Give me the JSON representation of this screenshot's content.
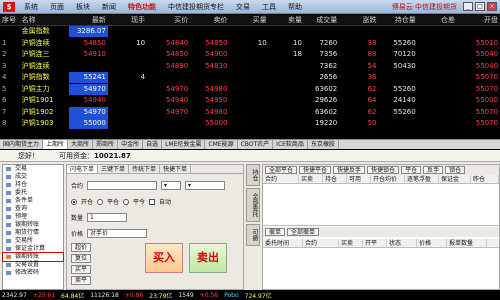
{
  "menubar": {
    "items": [
      "系统",
      "页面",
      "板块",
      "新闻",
      "特色功能",
      "中信建投期货专栏",
      "交易",
      "工具",
      "帮助"
    ],
    "brand": "博易云·中信建投期货",
    "trade_btn": "交易"
  },
  "quote": {
    "headers": [
      "序号",
      "名称",
      "最新",
      "现手",
      "买价",
      "卖价",
      "买量",
      "卖量",
      "成交量",
      "涨跌",
      "持仓量",
      "仓差",
      "开盘"
    ],
    "rows": [
      {
        "no": "",
        "name": "金属指数",
        "last": "3286.07",
        "vol": "",
        "bid": "",
        "ask": "",
        "bq": "",
        "aq": "",
        "tv": "",
        "chg": "",
        "oi": "",
        "oid": "",
        "open": ""
      },
      {
        "no": "1",
        "name": "沪铜连续",
        "last": "54850",
        "vol": "10",
        "bid": "54840",
        "ask": "54850",
        "bq": "10",
        "aq": "10",
        "tv": "7260",
        "chg": "38",
        "oi": "55260",
        "oid": "",
        "open": "55010"
      },
      {
        "no": "2",
        "name": "沪铜连三",
        "last": "54910",
        "vol": "",
        "bid": "54850",
        "ask": "54900",
        "bq": "",
        "aq": "18",
        "tv": "7356",
        "chg": "88",
        "oi": "70120",
        "oid": "",
        "open": "55040"
      },
      {
        "no": "3",
        "name": "沪铜连续",
        "last": "",
        "vol": "",
        "bid": "54890",
        "ask": "54830",
        "bq": "",
        "aq": "",
        "tv": "7362",
        "chg": "54",
        "oi": "50430",
        "oid": "",
        "open": "55040"
      },
      {
        "no": "4",
        "name": "沪铜指数",
        "last": "55241",
        "vol": "4",
        "bid": "",
        "ask": "",
        "bq": "",
        "aq": "",
        "tv": "2656",
        "chg": "36",
        "oi": "",
        "oid": "",
        "open": "55070"
      },
      {
        "no": "5",
        "name": "沪铜主力",
        "last": "54970",
        "vol": "",
        "bid": "54970",
        "ask": "54980",
        "bq": "",
        "aq": "",
        "tv": "63602",
        "chg": "62",
        "oi": "55260",
        "oid": "",
        "open": "55070"
      },
      {
        "no": "6",
        "name": "沪铜1901",
        "last": "54940",
        "vol": "",
        "bid": "54940",
        "ask": "54950",
        "bq": "",
        "aq": "",
        "tv": "29626",
        "chg": "64",
        "oi": "24140",
        "oid": "",
        "open": "55000"
      },
      {
        "no": "7",
        "name": "沪铜1902",
        "last": "54970",
        "vol": "",
        "bid": "54970",
        "ask": "54980",
        "bq": "",
        "aq": "",
        "tv": "63602",
        "chg": "62",
        "oi": "55260",
        "oid": "",
        "open": "55070"
      },
      {
        "no": "8",
        "name": "沪铜1903",
        "last": "55000",
        "vol": "",
        "bid": "",
        "ask": "55000",
        "bq": "",
        "aq": "",
        "tv": "19220",
        "chg": "50",
        "oi": "",
        "oid": "",
        "open": "55070"
      }
    ]
  },
  "tabs": [
    "国内期货主力",
    "上期所",
    "大商所",
    "郑商所",
    "中金所",
    "自选",
    "LME伦敦金属",
    "CME能源",
    "CBOT农产",
    "ICE软商品",
    "东京橡胶"
  ],
  "account": {
    "label": "您好！",
    "balance_label": "可用资金",
    "balance": "10021.87"
  },
  "leftnav": [
    "交易",
    "成交",
    "持仓",
    "委托",
    "条件单",
    "查询",
    "预埋",
    "银期转账",
    "期货行情",
    "交易所",
    "保证金计算",
    "银期转账",
    "交易设置",
    "修改密码"
  ],
  "order": {
    "tabs": [
      "闪电下单",
      "三键下单",
      "传统下单",
      "快捷下单"
    ],
    "contract_label": "合约",
    "open_label": "开仓",
    "close_label": "平仓",
    "closetoday_label": "平今",
    "auto_label": "自动",
    "qty_label": "数量",
    "qty_value": "1",
    "price_label": "价格",
    "price_value": "对手价",
    "side_buttons": [
      "超价",
      "复位",
      "买平",
      "卖平"
    ],
    "buy_label": "买入",
    "sell_label": "卖出"
  },
  "side_tabs": [
    "持仓",
    "全部委托",
    "可撤"
  ],
  "positions": {
    "buttons": [
      "全部平仓",
      "快捷平仓",
      "快捷反手",
      "快捷锁仓",
      "平仓",
      "反手",
      "锁仓"
    ],
    "headers": [
      "合约",
      "买卖",
      "持仓",
      "可用",
      "开仓均价",
      "逐笔浮盈",
      "保证金",
      "昨仓"
    ],
    "order_buttons": [
      "撤单",
      "全部撤单"
    ],
    "order_headers": [
      "委托时间",
      "合约",
      "买卖",
      "开平",
      "状态",
      "价格",
      "报单数量"
    ]
  },
  "status": {
    "items": [
      "2342.97",
      "+25.61",
      "64.84亿",
      "11126.18",
      "+0.86",
      "23.79亿",
      "1549",
      "+0.56",
      "Pobo",
      "724.97亿"
    ]
  }
}
